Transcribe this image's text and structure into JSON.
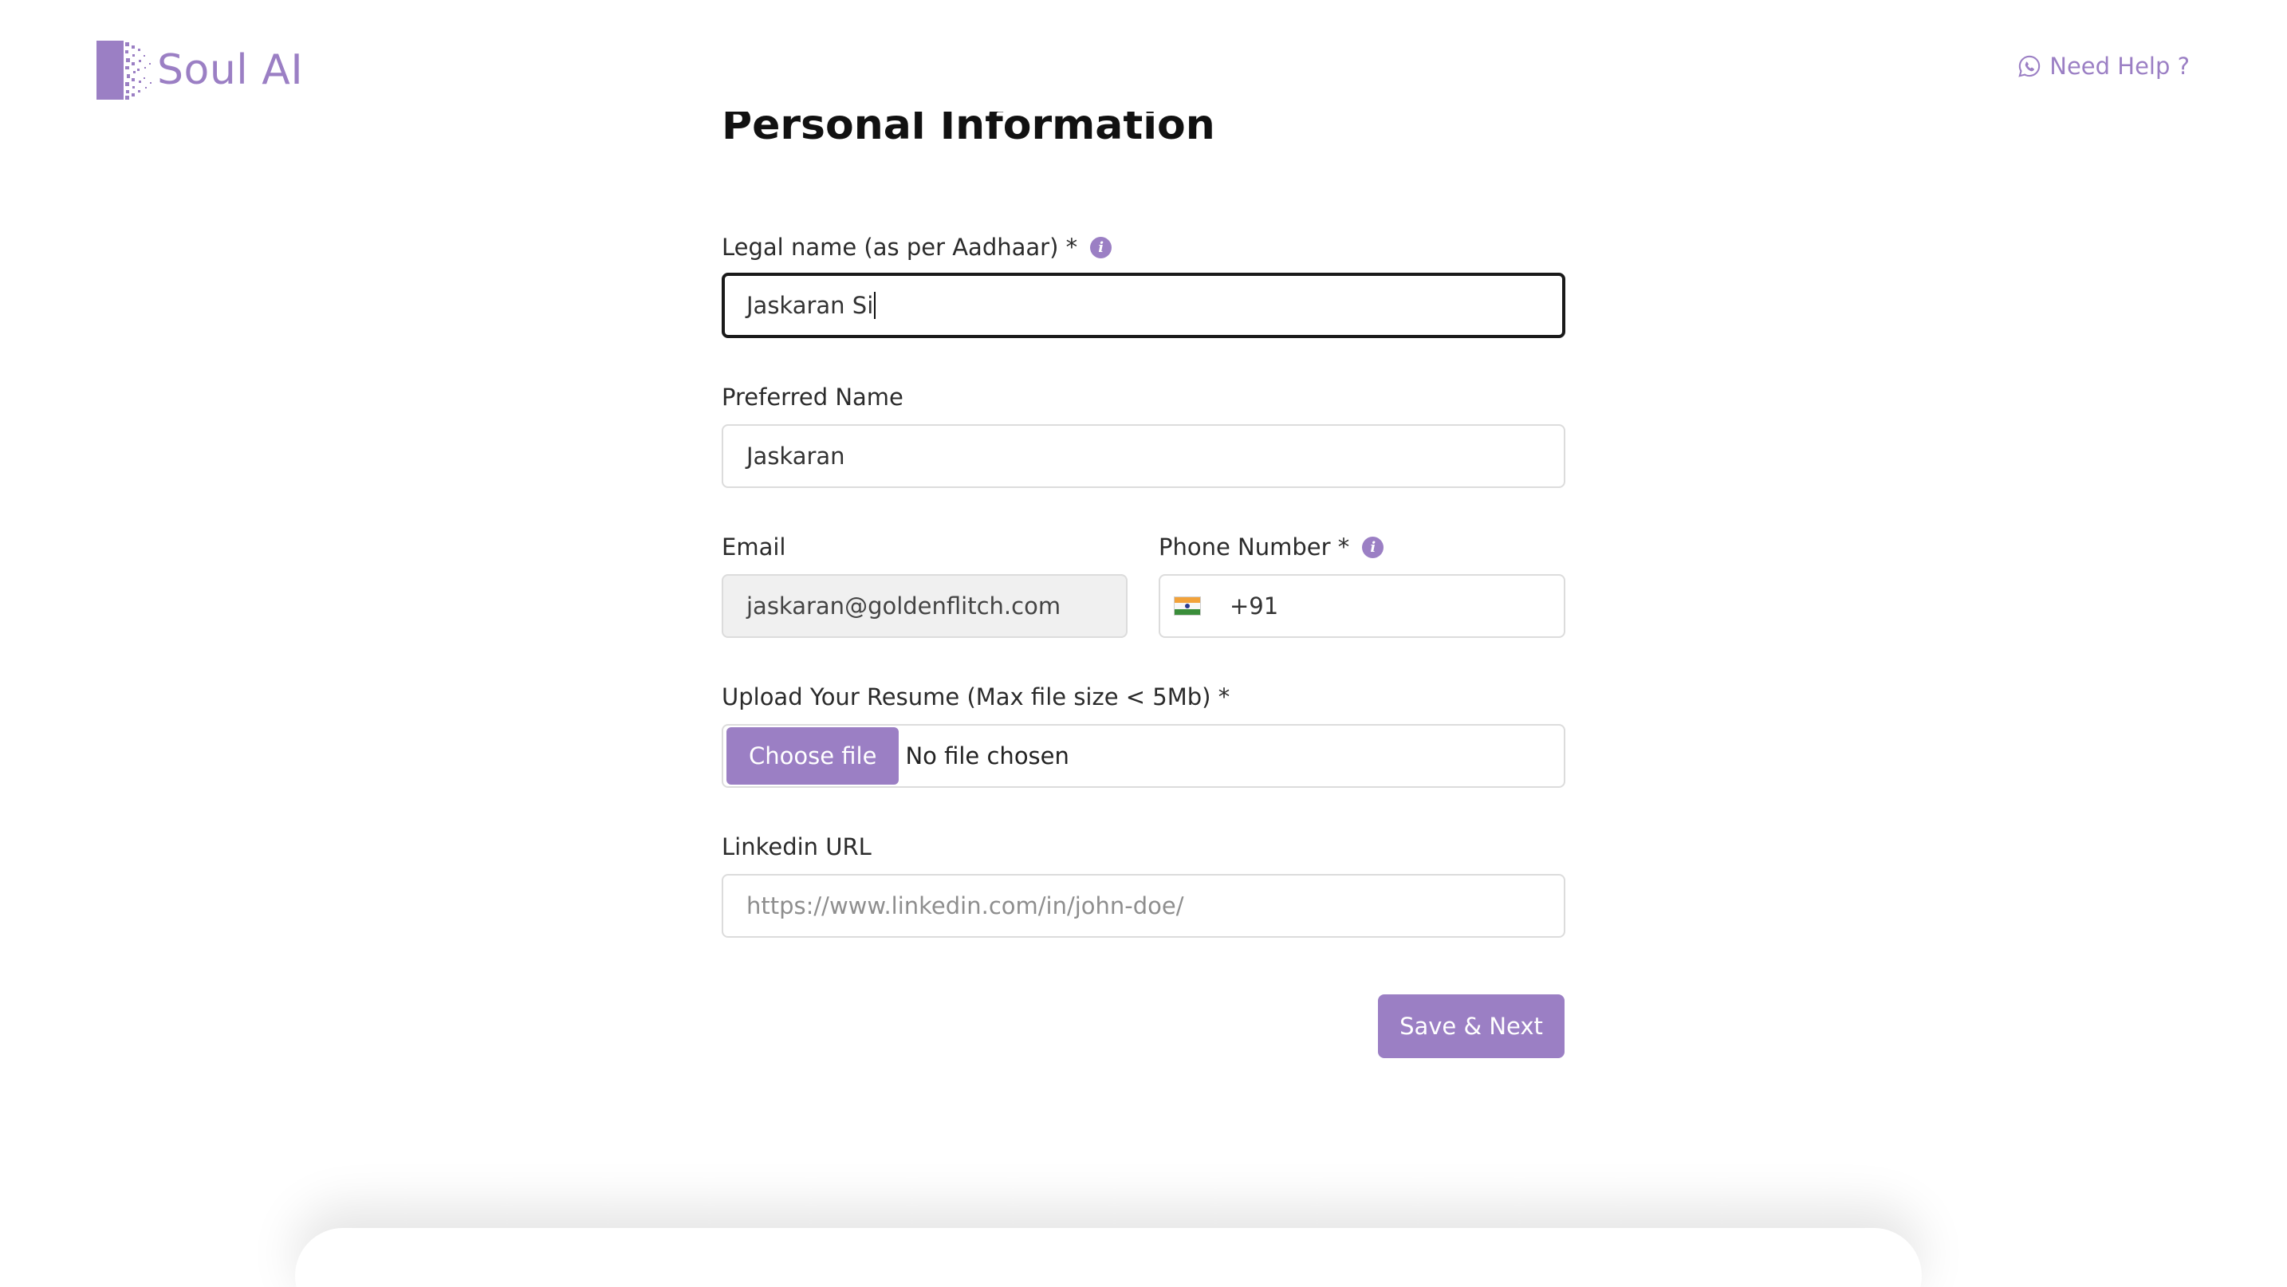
{
  "brand": {
    "name": "Soul AI",
    "accent_color": "#9b7fc4"
  },
  "header": {
    "help_label": "Need Help ?",
    "help_icon": "whatsapp-icon"
  },
  "section": {
    "title": "Personal Information"
  },
  "form": {
    "legal_name": {
      "label": "Legal name (as per Aadhaar) *",
      "value": "Jaskaran Si",
      "focused": true,
      "info_icon": "info-icon"
    },
    "preferred_name": {
      "label": "Preferred Name",
      "value": "Jaskaran"
    },
    "email": {
      "label": "Email",
      "value": "jaskaran@goldenflitch.com",
      "disabled": true
    },
    "phone": {
      "label": "Phone Number *",
      "country_flag": "india-flag-icon",
      "dial_code": "+91",
      "value": "",
      "info_icon": "info-icon"
    },
    "resume": {
      "label": "Upload Your Resume (Max file size < 5Mb) *",
      "button_label": "Choose file",
      "status": "No file chosen"
    },
    "linkedin": {
      "label": "Linkedin URL",
      "value": "",
      "placeholder": "https://www.linkedin.com/in/john-doe/"
    },
    "submit_label": "Save & Next"
  }
}
